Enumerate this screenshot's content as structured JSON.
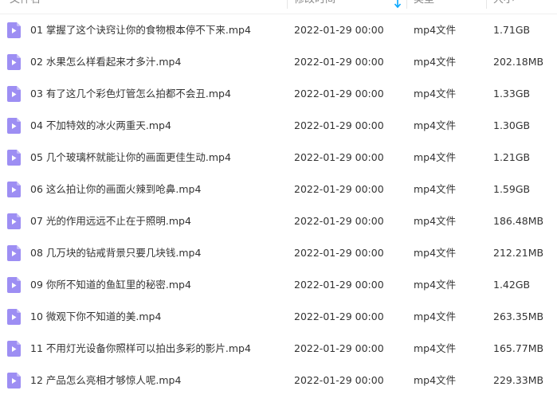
{
  "header": {
    "name_label": "文件名",
    "time_label": "修改时间",
    "type_label": "类型",
    "size_label": "大小"
  },
  "accent": "#9d8ef3",
  "sort_arrow_color": "#06a7ff",
  "files": [
    {
      "name": "01 掌握了这个诀窍让你的食物根本停不下来.mp4",
      "time": "2022-01-29 00:00",
      "type": "mp4文件",
      "size": "1.71GB"
    },
    {
      "name": "02 水果怎么样看起来才多汁.mp4",
      "time": "2022-01-29 00:00",
      "type": "mp4文件",
      "size": "202.18MB"
    },
    {
      "name": "03 有了这几个彩色灯管怎么拍都不会丑.mp4",
      "time": "2022-01-29 00:00",
      "type": "mp4文件",
      "size": "1.33GB"
    },
    {
      "name": "04 不加特效的冰火两重天.mp4",
      "time": "2022-01-29 00:00",
      "type": "mp4文件",
      "size": "1.30GB"
    },
    {
      "name": "05 几个玻璃杯就能让你的画面更佳生动.mp4",
      "time": "2022-01-29 00:00",
      "type": "mp4文件",
      "size": "1.21GB"
    },
    {
      "name": "06 这么拍让你的画面火辣到呛鼻.mp4",
      "time": "2022-01-29 00:00",
      "type": "mp4文件",
      "size": "1.59GB"
    },
    {
      "name": "07 光的作用远远不止在于照明.mp4",
      "time": "2022-01-29 00:00",
      "type": "mp4文件",
      "size": "186.48MB"
    },
    {
      "name": "08 几万块的钻戒背景只要几块钱.mp4",
      "time": "2022-01-29 00:00",
      "type": "mp4文件",
      "size": "212.21MB"
    },
    {
      "name": "09 你所不知道的鱼缸里的秘密.mp4",
      "time": "2022-01-29 00:00",
      "type": "mp4文件",
      "size": "1.42GB"
    },
    {
      "name": "10 微观下你不知道的美.mp4",
      "time": "2022-01-29 00:00",
      "type": "mp4文件",
      "size": "263.35MB"
    },
    {
      "name": "11 不用灯光设备你照样可以拍出多彩的影片.mp4",
      "time": "2022-01-29 00:00",
      "type": "mp4文件",
      "size": "165.77MB"
    },
    {
      "name": "12 产品怎么亮相才够惊人呢.mp4",
      "time": "2022-01-29 00:00",
      "type": "mp4文件",
      "size": "229.33MB"
    }
  ]
}
